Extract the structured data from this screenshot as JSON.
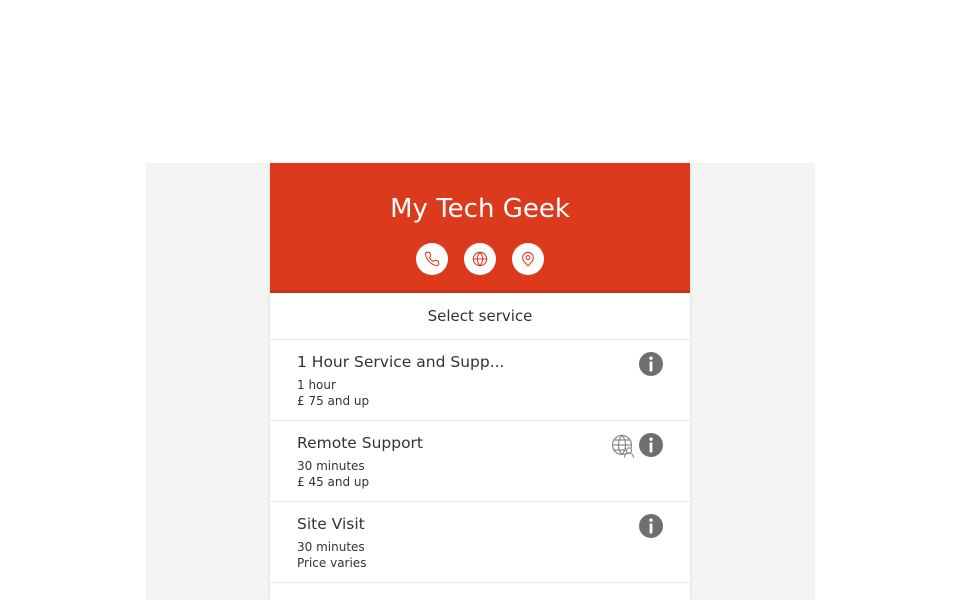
{
  "header": {
    "title": "My Tech Geek",
    "icons": [
      "phone-icon",
      "globe-icon",
      "map-pin-icon"
    ],
    "color": "#dc3a1c"
  },
  "subheader": {
    "label": "Select service"
  },
  "services": [
    {
      "name": "1 Hour Service and Supp...",
      "duration": "1 hour",
      "price": "£ 75 and up",
      "icons": [
        "info-icon"
      ]
    },
    {
      "name": "Remote Support",
      "duration": "30 minutes",
      "price": "£ 45 and up",
      "icons": [
        "remote-globe-user-icon",
        "info-icon"
      ]
    },
    {
      "name": "Site Visit",
      "duration": "30 minutes",
      "price": "Price varies",
      "icons": [
        "info-icon"
      ]
    }
  ]
}
